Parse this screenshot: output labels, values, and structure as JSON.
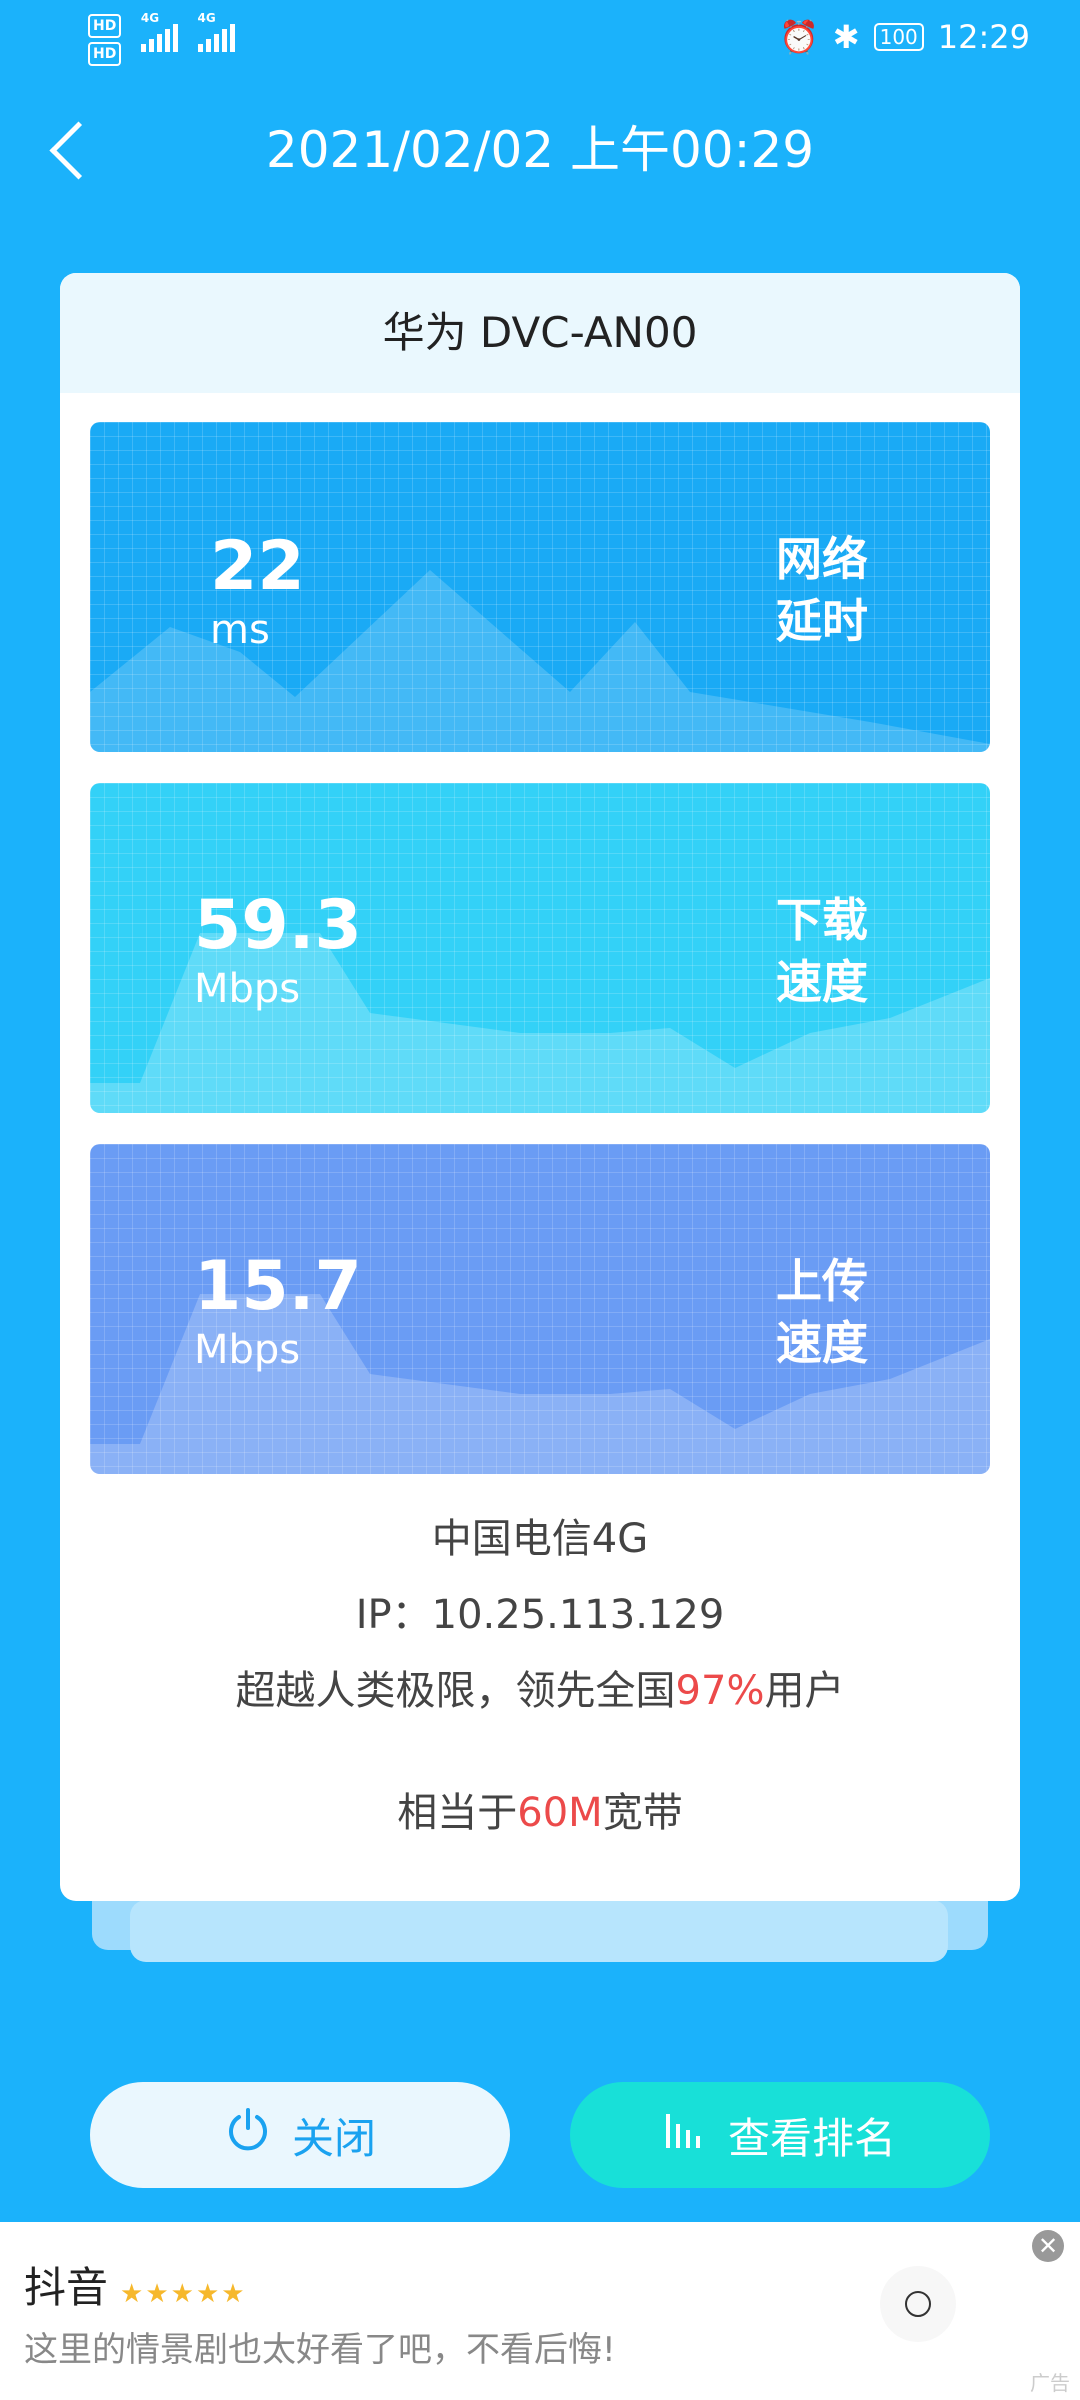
{
  "status_bar": {
    "hd1": "HD",
    "hd2": "HD",
    "net1": "4G",
    "net2": "4G",
    "battery": "100",
    "time": "12:29"
  },
  "header": {
    "title": "2021/02/02 上午00:29"
  },
  "card": {
    "device": "华为 DVC-AN00",
    "latency": {
      "value": "22",
      "unit": "ms",
      "label_line1": "网络",
      "label_line2": "延时"
    },
    "download": {
      "value": "59.3",
      "unit": "Mbps",
      "label_line1": "下载",
      "label_line2": "速度"
    },
    "upload": {
      "value": "15.7",
      "unit": "Mbps",
      "label_line1": "上传",
      "label_line2": "速度"
    },
    "carrier": "中国电信4G",
    "ip": "IP：10.25.113.129",
    "rank_prefix": "超越人类极限，领先全国",
    "rank_percent": "97%",
    "rank_suffix": "用户",
    "equiv_prefix": "相当于",
    "equiv_value": "60M",
    "equiv_suffix": "宽带"
  },
  "buttons": {
    "close": "关闭",
    "rank": "查看排名"
  },
  "ad": {
    "title": "抖音",
    "stars": "★★★★★",
    "text": "这里的情景剧也太好看了吧，不看后悔!",
    "tag": "广告",
    "close": "✕"
  },
  "colors": {
    "background": "#1bb2fb",
    "latency_panel": "#1aaaf5",
    "download_panel": "#33d1f7",
    "upload_panel": "#6a9cf4",
    "accent_red": "#ec4a4a"
  }
}
